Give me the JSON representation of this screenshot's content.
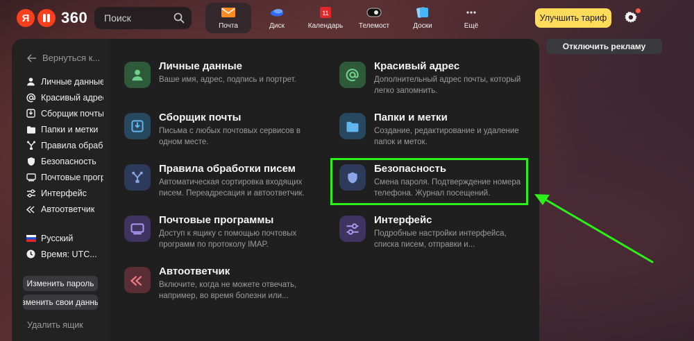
{
  "header": {
    "logo_ya": "Я",
    "logo_num": "360",
    "search_placeholder": "Поиск",
    "apps": [
      {
        "label": "Почта",
        "icon": "mail-icon",
        "active": true
      },
      {
        "label": "Диск",
        "icon": "disk-icon",
        "active": false
      },
      {
        "label": "Календарь",
        "icon": "calendar-icon",
        "badge": "11",
        "active": false
      },
      {
        "label": "Телемост",
        "icon": "telemost-icon",
        "active": false
      },
      {
        "label": "Доски",
        "icon": "boards-icon",
        "active": false
      },
      {
        "label": "Ещё",
        "icon": "more-icon",
        "active": false
      }
    ],
    "upgrade_label": "Улучшить тариф",
    "settings_icon": "gear-icon"
  },
  "sidebar": {
    "back_label": "Вернуться к...",
    "items": [
      {
        "label": "Личные данные",
        "icon": "person-icon"
      },
      {
        "label": "Красивый адрес",
        "icon": "at-icon"
      },
      {
        "label": "Сборщик почты",
        "icon": "collector-icon"
      },
      {
        "label": "Папки и метки",
        "icon": "folder-icon"
      },
      {
        "label": "Правила обработки писем",
        "icon": "rules-icon"
      },
      {
        "label": "Безопасность",
        "icon": "shield-icon"
      },
      {
        "label": "Почтовые программы",
        "icon": "mail-programs-icon"
      },
      {
        "label": "Интерфейс",
        "icon": "sliders-icon"
      },
      {
        "label": "Автоответчик",
        "icon": "autoreply-icon"
      }
    ],
    "language": "Русский",
    "timezone": "Время: UTC...",
    "change_password": "Изменить пароль",
    "change_other": "Изменить свои данные",
    "delete_label": "Удалить ящик"
  },
  "cards": [
    {
      "title": "Личные данные",
      "desc": "Ваше имя, адрес, подпись и портрет.",
      "icon": "person-icon",
      "color": "#2f5a3a"
    },
    {
      "title": "Красивый адрес",
      "desc": "Дополнительный адрес почты, который легко запомнить.",
      "icon": "at-icon",
      "color": "#2f5a3a"
    },
    {
      "title": "Сборщик почты",
      "desc": "Письма с любых почтовых сервисов в одном месте.",
      "icon": "collector-icon",
      "color": "#27485e"
    },
    {
      "title": "Папки и метки",
      "desc": "Создание, редактирование и удаление папок и меток.",
      "icon": "folder-icon",
      "color": "#27485e"
    },
    {
      "title": "Правила обработки писем",
      "desc": "Автоматическая сортировка входящих писем. Переадресация и автоответчик.",
      "icon": "rules-icon",
      "color": "#2d3a5a"
    },
    {
      "title": "Безопасность",
      "desc": "Смена пароля. Подтверждение номера телефона. Журнал посещений.",
      "icon": "shield-icon",
      "color": "#2d3a5a"
    },
    {
      "title": "Почтовые программы",
      "desc": "Доступ к ящику с помощью почтовых программ по протоколу IMAP.",
      "icon": "mail-programs-icon",
      "color": "#3d3560"
    },
    {
      "title": "Интерфейс",
      "desc": "Подробные настройки интерфейса, списка писем, отправки и...",
      "icon": "sliders-icon",
      "color": "#3d3560"
    },
    {
      "title": "Автоответчик",
      "desc": "Включите, когда не можете отвечать, например, во время болезни или...",
      "icon": "autoreply-icon",
      "color": "#5a2e35"
    }
  ],
  "right": {
    "disable_ads": "Отключить рекламу"
  },
  "colors": {
    "highlight": "#2cf01a",
    "upgrade": "#ffdb5a",
    "logo": "#fc3f1d"
  }
}
